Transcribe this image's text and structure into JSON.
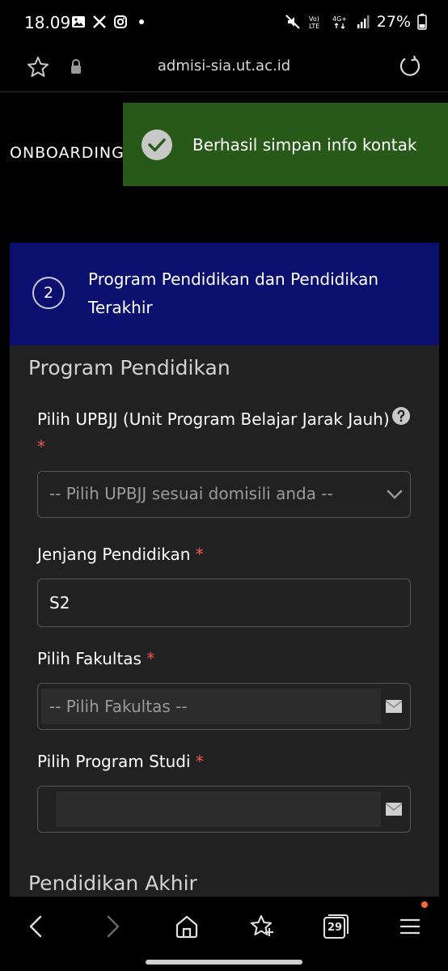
{
  "status_bar": {
    "time": "18.09",
    "battery": "27%",
    "left_icons": [
      "gallery-icon",
      "x-icon",
      "instagram-icon",
      "dot-icon"
    ],
    "right_icons": [
      "mute-icon",
      "volte-icon",
      "4g-icon",
      "signal-icon",
      "battery-icon"
    ],
    "volte_label": "Vo)\nLTE",
    "network_label": "4G+"
  },
  "browser": {
    "url": "admisi-sia.ut.ac.id"
  },
  "page": {
    "heading": "ONBOARDING"
  },
  "toast": {
    "message": "Berhasil simpan info kontak",
    "color": "#275a18"
  },
  "step": {
    "number": "2",
    "title": "Program Pendidikan dan Pendidikan Terakhir",
    "header_color": "#0b0f6e"
  },
  "section_program": {
    "title": "Program Pendidikan",
    "upbjj": {
      "label": "Pilih UPBJJ (Unit Program Belajar Jarak Jauh)",
      "required": "*",
      "value": "-- Pilih UPBJJ sesuai domisili anda --"
    },
    "jenjang": {
      "label": "Jenjang Pendidikan",
      "required": "*",
      "value": "S2"
    },
    "fakultas": {
      "label": "Pilih Fakultas",
      "required": "*",
      "value": "-- Pilih Fakultas --"
    },
    "prodi": {
      "label": "Pilih Program Studi",
      "required": "*",
      "value": ""
    }
  },
  "section_akhir": {
    "title": "Pendidikan Akhir"
  },
  "bottom_nav": {
    "tabs_count": "29",
    "items": [
      "back-icon",
      "forward-icon",
      "home-icon",
      "bookmarks-icon",
      "tabs-icon",
      "menu-icon"
    ]
  }
}
